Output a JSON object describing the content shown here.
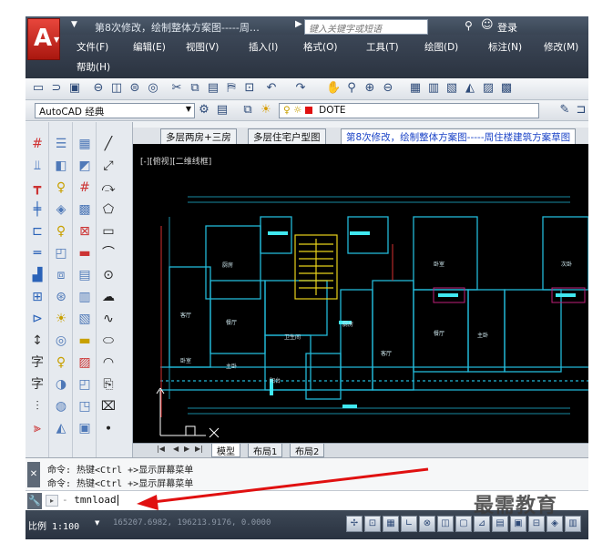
{
  "titlebar": {
    "title": "第8次修改，绘制整体方案图-----周…",
    "search_placeholder": "键入关键字或短语",
    "login": "登录"
  },
  "menu": {
    "row1": [
      "文件(F)",
      "编辑(E)",
      "视图(V)",
      "插入(I)",
      "格式(O)",
      "工具(T)",
      "绘图(D)",
      "标注(N)",
      "修改(M)"
    ],
    "row2": [
      "帮助(H)"
    ]
  },
  "toolbar2": {
    "workspace": "AutoCAD 经典",
    "layer": "DOTE"
  },
  "doc_tabs": [
    "多层两房+三房",
    "多层住宅户型图",
    "第8次修改，绘制整体方案图-----周住楼建筑方案草图"
  ],
  "drawing": {
    "view_label": "[-][俯视][二维线框]",
    "room_labels": [
      "厨房",
      "客厅",
      "卧室",
      "餐厅",
      "主卧",
      "卫生间",
      "阳台",
      "厨房",
      "客厅",
      "卧室",
      "餐厅",
      "主卧",
      "次卧"
    ]
  },
  "layout_tabs": [
    "模型",
    "布局1",
    "布局2"
  ],
  "command": {
    "history": [
      "命令: 热键<Ctrl +>显示屏幕菜单",
      "命令: 热键<Ctrl +>显示屏幕菜单"
    ],
    "input_value": "tmnload"
  },
  "status": {
    "scale": "比例 1:100",
    "coords": "165207.6982, 196213.9176, 0.0000"
  },
  "watermark": "最需教育",
  "colors": {
    "accent_red": "#e01010",
    "drawing_bg": "#000000",
    "wall_cyan": "#22b8d8",
    "stair_yellow": "#e8d21a"
  }
}
